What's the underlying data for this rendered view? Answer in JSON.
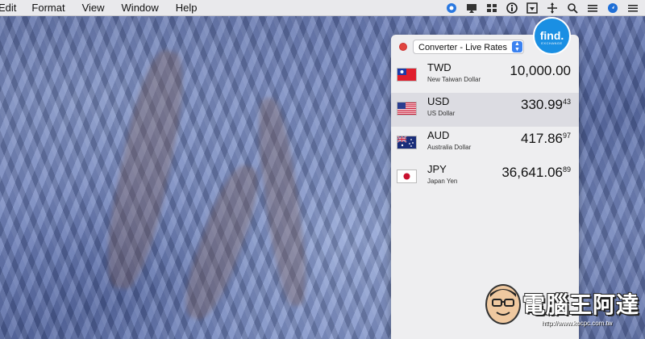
{
  "menubar": {
    "items": [
      "Edit",
      "Format",
      "View",
      "Window",
      "Help"
    ],
    "status_icons": [
      "target-icon",
      "cast-icon",
      "grid-icon",
      "info-icon",
      "download-icon",
      "move-icon",
      "search-icon",
      "list-icon",
      "compass-icon",
      "menu-icon"
    ]
  },
  "converter": {
    "mode": "Converter - Live Rates",
    "logo_text": "find.",
    "logo_subtext": "EXCHANGE",
    "rows": [
      {
        "code": "TWD",
        "name": "New Taiwan Dollar",
        "amount": "10,000.00",
        "amount_small": "",
        "flag": "tw-flag-icon",
        "highlighted": false
      },
      {
        "code": "USD",
        "name": "US Dollar",
        "amount": "330.99",
        "amount_small": "43",
        "flag": "us-flag-icon",
        "highlighted": true
      },
      {
        "code": "AUD",
        "name": "Australia Dollar",
        "amount": "417.86",
        "amount_small": "97",
        "flag": "au-flag-icon",
        "highlighted": false
      },
      {
        "code": "JPY",
        "name": "Japan Yen",
        "amount": "36,641.06",
        "amount_small": "89",
        "flag": "jp-flag-icon",
        "highlighted": false
      }
    ]
  },
  "watermark": {
    "text": "電腦王阿達",
    "url": "http://www.kocpc.com.tw"
  },
  "colors": {
    "accent": "#3b82f0",
    "logo": "#1a8fe3",
    "close": "#e0443e"
  }
}
